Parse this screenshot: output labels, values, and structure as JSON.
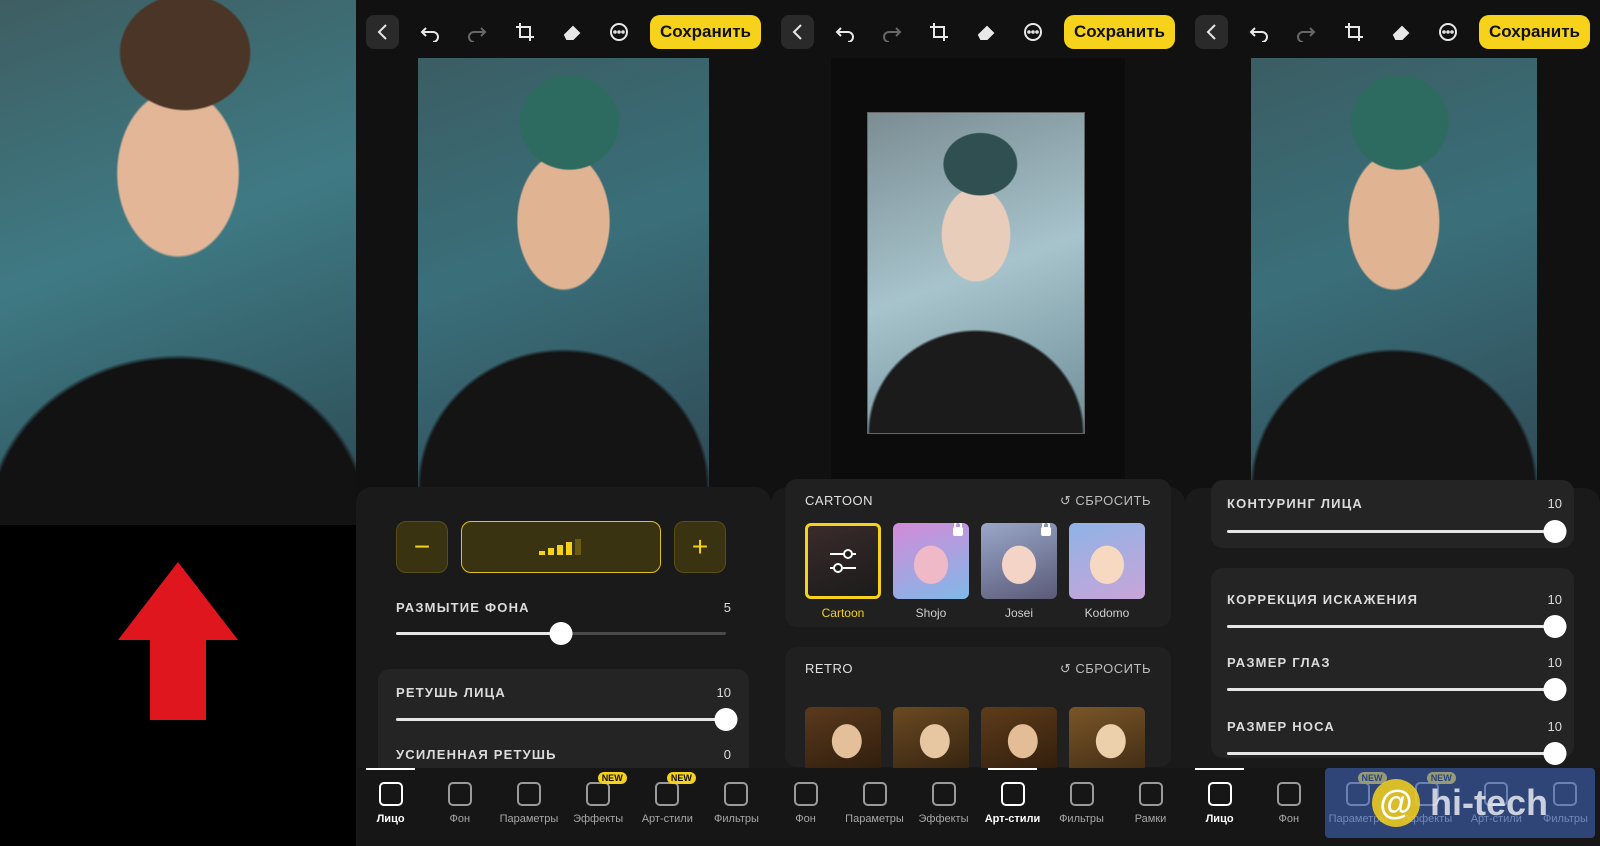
{
  "toolbar": {
    "save_label": "Сохранить"
  },
  "panel1": {
    "sliders": [
      {
        "label": "РАЗМЫТИЕ ФОНА",
        "value": "5",
        "fraction": 0.5
      },
      {
        "label": "РЕТУШЬ ЛИЦА",
        "value": "10",
        "fraction": 1.0
      },
      {
        "label": "УСИЛЕННАЯ РЕТУШЬ",
        "value": "0",
        "fraction": 0.0
      }
    ],
    "stepper": {
      "minus": "−",
      "plus": "+"
    },
    "nav": [
      {
        "label": "Лицо",
        "icon": "face-icon",
        "active": true
      },
      {
        "label": "Фон",
        "icon": "image-icon"
      },
      {
        "label": "Параметры",
        "icon": "sliders-icon"
      },
      {
        "label": "Эффекты",
        "icon": "sparkle-icon",
        "badge": "NEW"
      },
      {
        "label": "Арт-стили",
        "icon": "art-icon",
        "badge": "NEW"
      },
      {
        "label": "Фильтры",
        "icon": "filters-icon"
      }
    ]
  },
  "panel2": {
    "cartoon": {
      "title": "CARTOON",
      "reset": "↺ СБРОСИТЬ",
      "styles": [
        {
          "label": "Cartoon",
          "selected": true
        },
        {
          "label": "Shojo",
          "locked": true
        },
        {
          "label": "Josei",
          "locked": true
        },
        {
          "label": "Kodomo"
        }
      ]
    },
    "retro": {
      "title": "RETRO",
      "reset": "↺ СБРОСИТЬ"
    },
    "nav": [
      {
        "label": "Фон",
        "icon": "image-icon"
      },
      {
        "label": "Параметры",
        "icon": "sliders-icon"
      },
      {
        "label": "Эффекты",
        "icon": "sparkle-icon"
      },
      {
        "label": "Арт-стили",
        "icon": "art-icon",
        "active": true
      },
      {
        "label": "Фильтры",
        "icon": "filters-icon"
      },
      {
        "label": "Рамки",
        "icon": "frame-icon"
      }
    ]
  },
  "panel3": {
    "sliders": [
      {
        "label": "КОНТУРИНГ ЛИЦА",
        "value": "10",
        "fraction": 1.0
      },
      {
        "label": "КОРРЕКЦИЯ ИСКАЖЕНИЯ",
        "value": "10",
        "fraction": 1.0
      },
      {
        "label": "РАЗМЕР ГЛАЗ",
        "value": "10",
        "fraction": 1.0
      },
      {
        "label": "РАЗМЕР НОСА",
        "value": "10",
        "fraction": 1.0
      }
    ],
    "nav": [
      {
        "label": "Лицо",
        "icon": "face-icon",
        "active": true
      },
      {
        "label": "Фон",
        "icon": "image-icon"
      },
      {
        "label": "Параметры",
        "icon": "sliders-icon",
        "badge": "NEW"
      },
      {
        "label": "Эффекты",
        "icon": "sparkle-icon",
        "badge": "NEW"
      },
      {
        "label": "Арт-стили",
        "icon": "art-icon"
      },
      {
        "label": "Фильтры",
        "icon": "filters-icon"
      }
    ]
  },
  "watermark": {
    "text": "hi-tech",
    "at": "@"
  },
  "colors": {
    "accent": "#f6d21b",
    "arrow": "#e0161e"
  }
}
